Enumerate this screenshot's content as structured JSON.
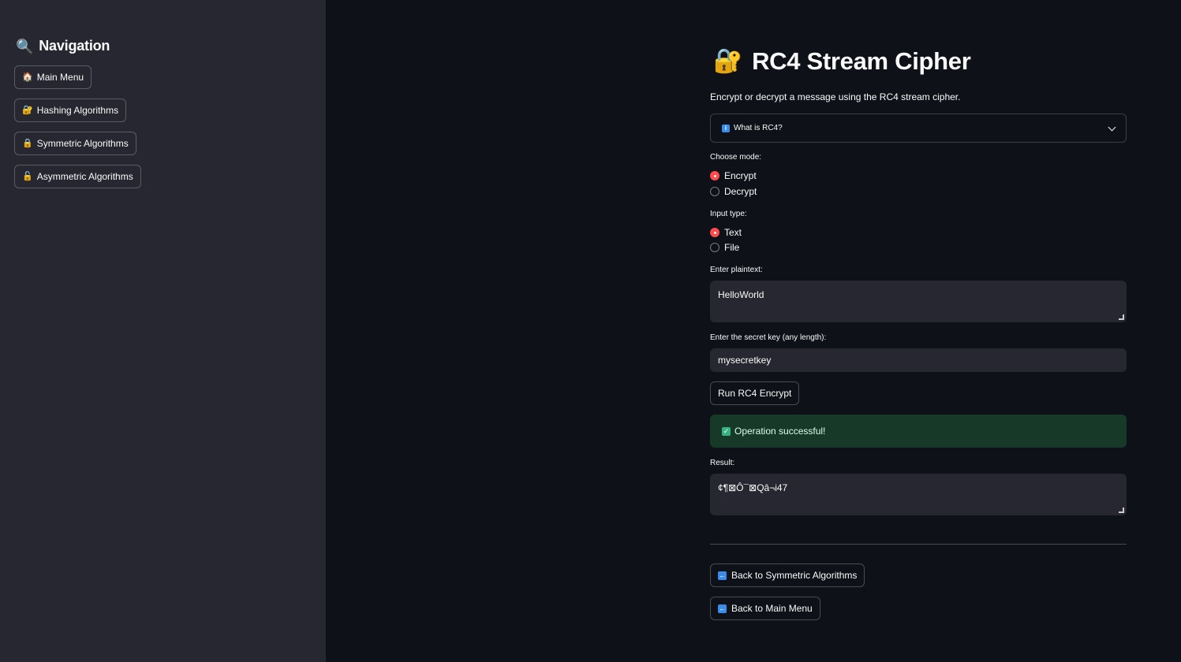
{
  "sidebar": {
    "title": "Navigation",
    "title_icon": "🔍",
    "items": [
      {
        "icon": "🏠",
        "label": "Main Menu"
      },
      {
        "icon": "🔐",
        "label": "Hashing Algorithms"
      },
      {
        "icon": "🔒",
        "label": "Symmetric Algorithms"
      },
      {
        "icon": "🔓",
        "label": "Asymmetric Algorithms"
      }
    ]
  },
  "main": {
    "title_icon": "🔐",
    "title": "RC4 Stream Cipher",
    "subtitle": "Encrypt or decrypt a message using the RC4 stream cipher.",
    "expander": {
      "icon": "i",
      "label": "What is RC4?"
    },
    "mode": {
      "label": "Choose mode:",
      "options": [
        "Encrypt",
        "Decrypt"
      ],
      "selected": "Encrypt"
    },
    "input_type": {
      "label": "Input type:",
      "options": [
        "Text",
        "File"
      ],
      "selected": "Text"
    },
    "plaintext": {
      "label": "Enter plaintext:",
      "value": "HelloWorld"
    },
    "key": {
      "label": "Enter the secret key (any length):",
      "value": "mysecretkey"
    },
    "run_button": "Run RC4 Encrypt",
    "success": {
      "icon": "✓",
      "text": "Operation successful!"
    },
    "result": {
      "label": "Result:",
      "value": "¢¶⊠Ô¯⊠Qâ¬i47"
    },
    "back_buttons": [
      {
        "icon": "←",
        "label": "Back to Symmetric Algorithms"
      },
      {
        "icon": "←",
        "label": "Back to Main Menu"
      }
    ]
  },
  "colors": {
    "background": "#0e1117",
    "sidebar": "#262730",
    "accent": "#ff4b4b",
    "success_bg": "#173928"
  }
}
